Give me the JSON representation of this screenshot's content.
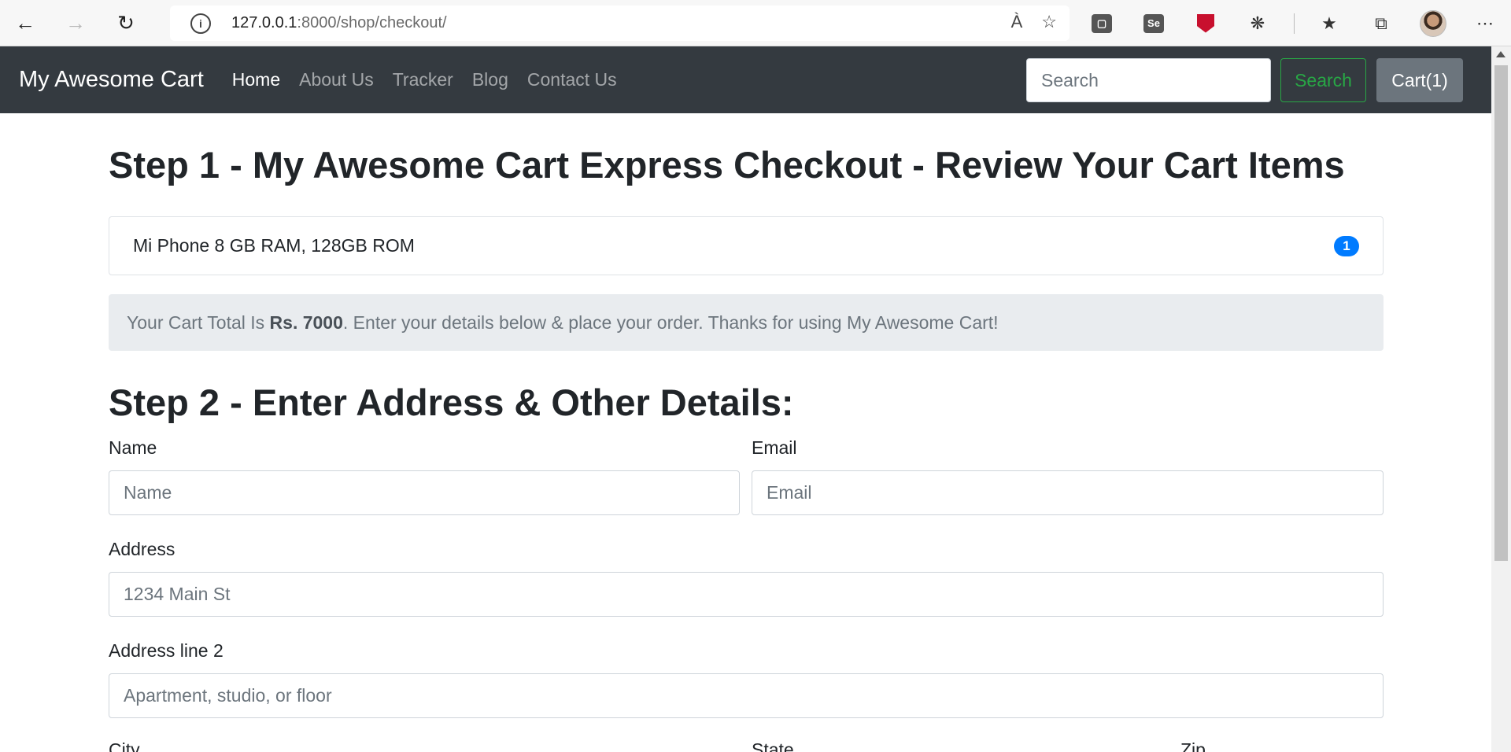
{
  "browser": {
    "url_host": "127.0.0.1",
    "url_path": ":8000/shop/checkout/",
    "read_aloud": "À",
    "extensions": [
      "Se"
    ]
  },
  "navbar": {
    "brand": "My Awesome Cart",
    "links": [
      "Home",
      "About Us",
      "Tracker",
      "Blog",
      "Contact Us"
    ],
    "search_placeholder": "Search",
    "search_button": "Search",
    "cart_button": "Cart(1)"
  },
  "step1": {
    "title": "Step 1 - My Awesome Cart Express Checkout - Review Your Cart Items",
    "items": [
      {
        "name": "Mi Phone 8 GB RAM, 128GB ROM",
        "qty": "1"
      }
    ],
    "total_prefix": "Your Cart Total Is ",
    "total_amount": "Rs. 7000",
    "total_suffix": ". Enter your details below & place your order. Thanks for using My Awesome Cart!"
  },
  "step2": {
    "title": "Step 2 - Enter Address & Other Details:",
    "name_label": "Name",
    "name_placeholder": "Name",
    "email_label": "Email",
    "email_placeholder": "Email",
    "address_label": "Address",
    "address_placeholder": "1234 Main St",
    "address2_label": "Address line 2",
    "address2_placeholder": "Apartment, studio, or floor",
    "city_label": "City",
    "state_label": "State",
    "zip_label": "Zip"
  }
}
